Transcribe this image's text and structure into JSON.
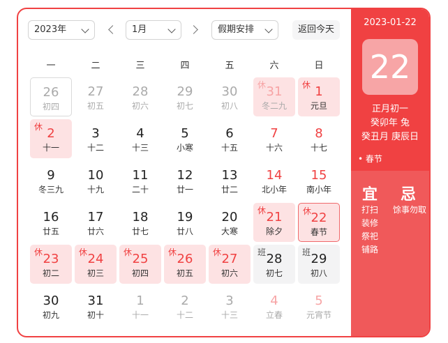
{
  "toolbar": {
    "year": "2023年",
    "month": "1月",
    "holiday_select": "假期安排",
    "today_button": "返回今天"
  },
  "weekdays": [
    "一",
    "二",
    "三",
    "四",
    "五",
    "六",
    "日"
  ],
  "days": [
    {
      "day": "26",
      "lunar": "初四",
      "other": true,
      "selected": true
    },
    {
      "day": "27",
      "lunar": "初五",
      "other": true
    },
    {
      "day": "28",
      "lunar": "初六",
      "other": true
    },
    {
      "day": "29",
      "lunar": "初七",
      "other": true
    },
    {
      "day": "30",
      "lunar": "初八",
      "other": true
    },
    {
      "day": "31",
      "lunar": "冬二九",
      "other": true,
      "tag": "休",
      "holiday": true
    },
    {
      "day": "1",
      "lunar": "元旦",
      "tag": "休",
      "holiday": true
    },
    {
      "day": "2",
      "lunar": "十一",
      "tag": "休",
      "holiday": true
    },
    {
      "day": "3",
      "lunar": "十二"
    },
    {
      "day": "4",
      "lunar": "十三"
    },
    {
      "day": "5",
      "lunar": "小寒"
    },
    {
      "day": "6",
      "lunar": "十五"
    },
    {
      "day": "7",
      "lunar": "十六",
      "red": true
    },
    {
      "day": "8",
      "lunar": "十七",
      "red": true
    },
    {
      "day": "9",
      "lunar": "冬三九"
    },
    {
      "day": "10",
      "lunar": "十九"
    },
    {
      "day": "11",
      "lunar": "二十"
    },
    {
      "day": "12",
      "lunar": "廿一"
    },
    {
      "day": "13",
      "lunar": "廿二"
    },
    {
      "day": "14",
      "lunar": "北小年",
      "red": true
    },
    {
      "day": "15",
      "lunar": "南小年",
      "red": true
    },
    {
      "day": "16",
      "lunar": "廿五"
    },
    {
      "day": "17",
      "lunar": "廿六"
    },
    {
      "day": "18",
      "lunar": "廿七"
    },
    {
      "day": "19",
      "lunar": "廿八"
    },
    {
      "day": "20",
      "lunar": "大寒"
    },
    {
      "day": "21",
      "lunar": "除夕",
      "tag": "休",
      "holiday": true
    },
    {
      "day": "22",
      "lunar": "春节",
      "tag": "休",
      "holiday": true,
      "today": true
    },
    {
      "day": "23",
      "lunar": "初二",
      "tag": "休",
      "holiday": true
    },
    {
      "day": "24",
      "lunar": "初三",
      "tag": "休",
      "holiday": true
    },
    {
      "day": "25",
      "lunar": "初四",
      "tag": "休",
      "holiday": true
    },
    {
      "day": "26",
      "lunar": "初五",
      "tag": "休",
      "holiday": true
    },
    {
      "day": "27",
      "lunar": "初六",
      "tag": "休",
      "holiday": true
    },
    {
      "day": "28",
      "lunar": "初七",
      "tag": "班",
      "work": true
    },
    {
      "day": "29",
      "lunar": "初八",
      "tag": "班",
      "work": true
    },
    {
      "day": "30",
      "lunar": "初九"
    },
    {
      "day": "31",
      "lunar": "初十"
    },
    {
      "day": "1",
      "lunar": "十一",
      "other": true
    },
    {
      "day": "2",
      "lunar": "十二",
      "other": true
    },
    {
      "day": "3",
      "lunar": "十三",
      "other": true
    },
    {
      "day": "4",
      "lunar": "立春",
      "other": true,
      "red": true
    },
    {
      "day": "5",
      "lunar": "元宵节",
      "other": true,
      "red": true
    }
  ],
  "side": {
    "date": "2023-01-22",
    "big_day": "22",
    "lunar_date": "正月初一",
    "year_ganzhi": "癸卯年 兔",
    "month_day_ganzhi": "癸丑月 庚辰日",
    "festival": "• 春节",
    "yi_title": "宜",
    "ji_title": "忌",
    "yi_items": [
      "打扫",
      "装修",
      "祭祀",
      "铺路"
    ],
    "ji_items": [
      "馀事勿取"
    ]
  },
  "colors": {
    "accent": "#f04142",
    "holiday_bg": "#fde2e3",
    "work_bg": "#f3f3f4",
    "side_lower": "#f0595a"
  }
}
